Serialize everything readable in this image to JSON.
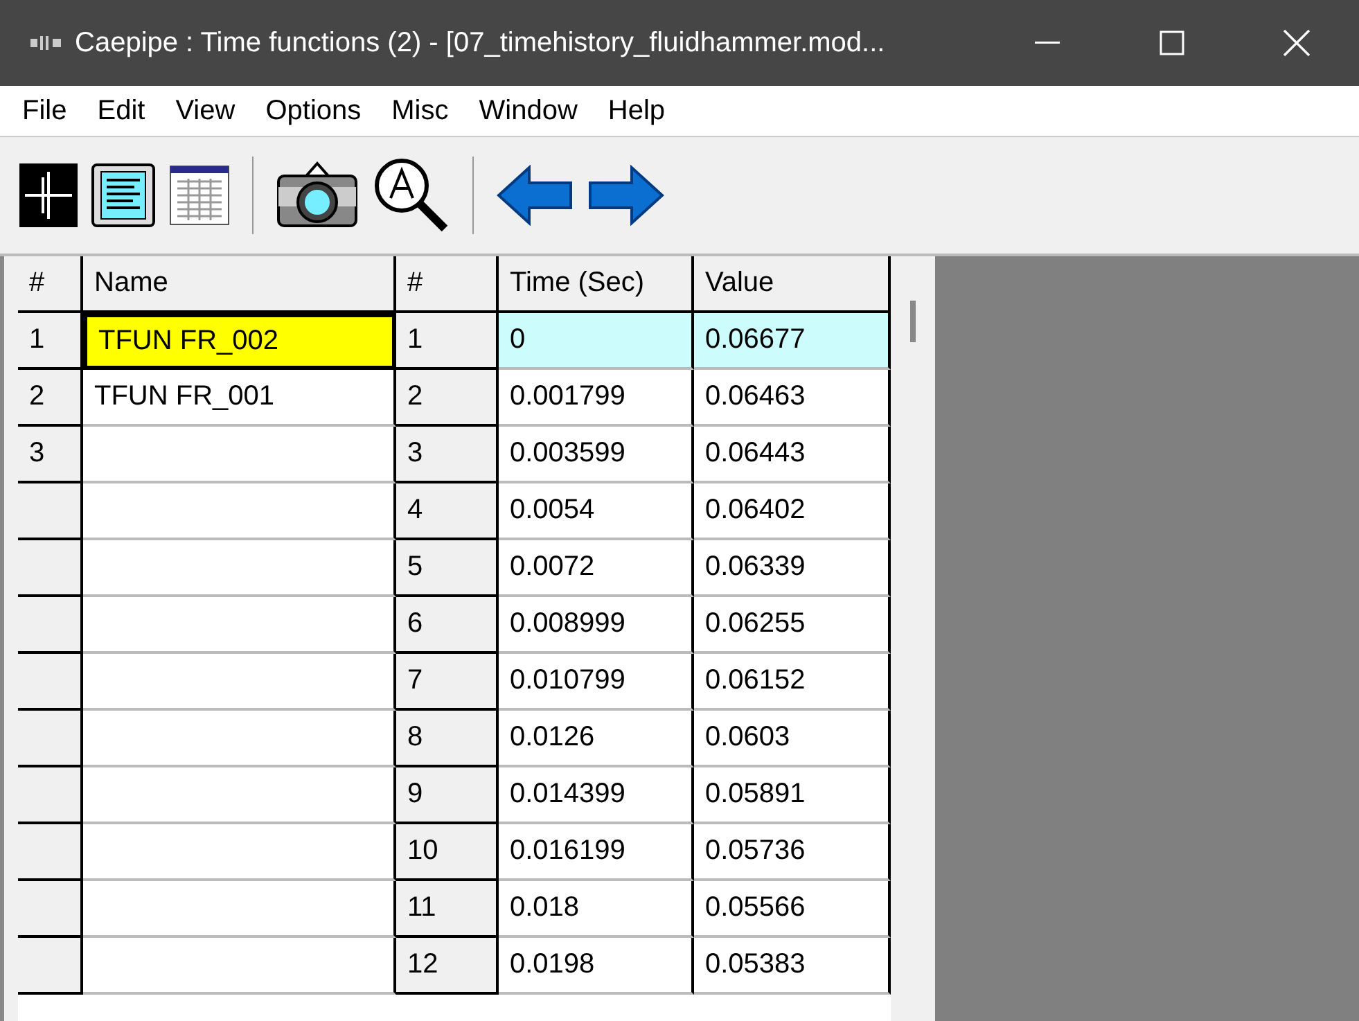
{
  "window": {
    "title": "Caepipe : Time functions  (2)  -  [07_timehistory_fluidhammer.mod..."
  },
  "menu": [
    "File",
    "Edit",
    "View",
    "Options",
    "Misc",
    "Window",
    "Help"
  ],
  "functions_table": {
    "columns": [
      "#",
      "Name"
    ],
    "rows": [
      {
        "number": "1",
        "name": "TFUN FR_002",
        "selected": true
      },
      {
        "number": "2",
        "name": "TFUN FR_001",
        "selected": false
      },
      {
        "number": "3",
        "name": "",
        "selected": false
      }
    ]
  },
  "points_table": {
    "columns": [
      "#",
      "Time (Sec)",
      "Value"
    ],
    "rows": [
      {
        "number": "1",
        "time": "0",
        "value": "0.06677",
        "selected": true
      },
      {
        "number": "2",
        "time": "0.001799",
        "value": "0.06463",
        "selected": false
      },
      {
        "number": "3",
        "time": "0.003599",
        "value": "0.06443",
        "selected": false
      },
      {
        "number": "4",
        "time": "0.0054",
        "value": "0.06402",
        "selected": false
      },
      {
        "number": "5",
        "time": "0.0072",
        "value": "0.06339",
        "selected": false
      },
      {
        "number": "6",
        "time": "0.008999",
        "value": "0.06255",
        "selected": false
      },
      {
        "number": "7",
        "time": "0.010799",
        "value": "0.06152",
        "selected": false
      },
      {
        "number": "8",
        "time": "0.0126",
        "value": "0.0603",
        "selected": false
      },
      {
        "number": "9",
        "time": "0.014399",
        "value": "0.05891",
        "selected": false
      },
      {
        "number": "10",
        "time": "0.016199",
        "value": "0.05736",
        "selected": false
      },
      {
        "number": "11",
        "time": "0.018",
        "value": "0.05566",
        "selected": false
      },
      {
        "number": "12",
        "time": "0.0198",
        "value": "0.05383",
        "selected": false
      }
    ]
  }
}
